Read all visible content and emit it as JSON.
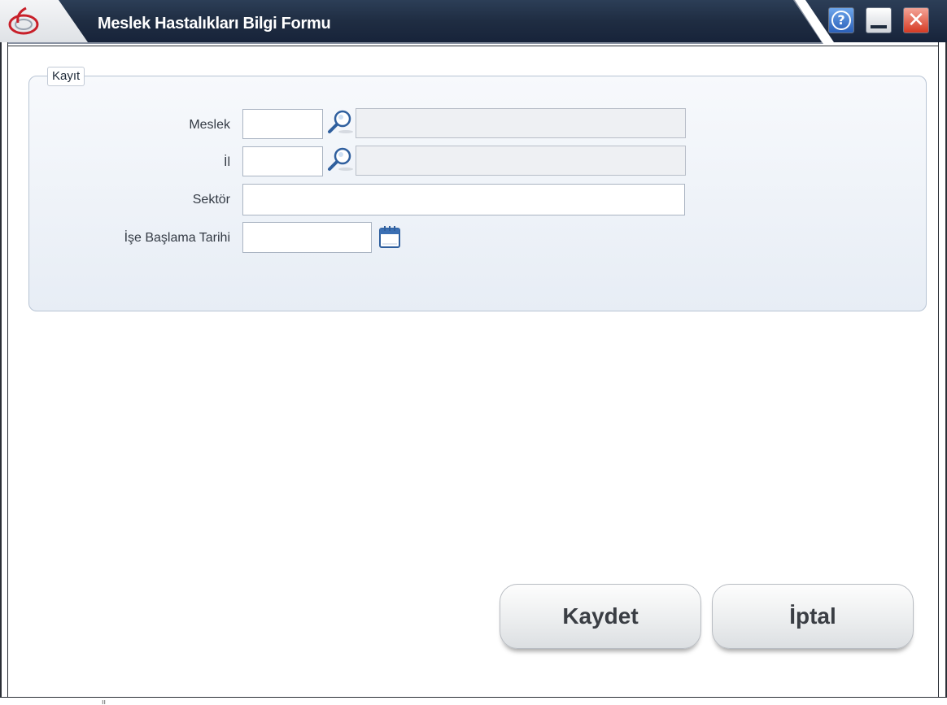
{
  "window": {
    "title": "Meslek Hastalıkları Bilgi Formu",
    "titlebar_buttons": {
      "help": "help-icon",
      "minimize": "minimize-icon",
      "close": "close-icon"
    },
    "help_glyph": "?",
    "close_glyph": "✕"
  },
  "form": {
    "legend": "Kayıt",
    "fields": {
      "meslek": {
        "label": "Meslek",
        "code_value": "",
        "description_value": ""
      },
      "il": {
        "label": "İl",
        "code_value": "",
        "description_value": ""
      },
      "sektor": {
        "label": "Sektör",
        "value": ""
      },
      "ise_baslama_tarihi": {
        "label": "İşe Başlama Tarihi",
        "value": ""
      }
    }
  },
  "actions": {
    "save_label": "Kaydet",
    "cancel_label": "İptal"
  },
  "colors": {
    "titlebar": "#1f2d42",
    "panel_background": "#e7edf5",
    "panel_border": "#b8c4d4",
    "button_text": "#3a3e44"
  }
}
